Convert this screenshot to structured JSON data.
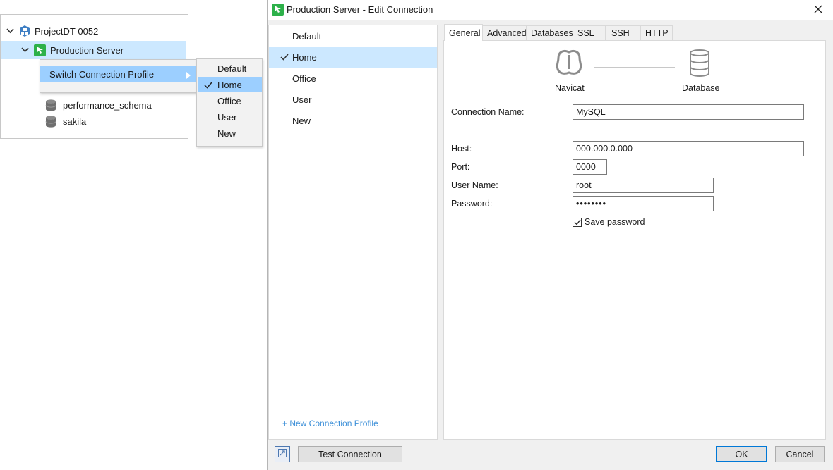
{
  "tree": {
    "project": "ProjectDT-0052",
    "connection": "Production Server",
    "databases": [
      "performance_schema",
      "sakila"
    ]
  },
  "context_menu": {
    "item": "Switch Connection Profile",
    "submenu": [
      "Default",
      "Home",
      "Office",
      "User",
      "New"
    ],
    "checked": "Home"
  },
  "dialog": {
    "title": "Production Server - Edit Connection",
    "profiles": [
      "Default",
      "Home",
      "Office",
      "User",
      "New"
    ],
    "selected_profile": "Home",
    "new_profile_link": "+ New Connection Profile",
    "tabs": [
      "General",
      "Advanced",
      "Databases",
      "SSL",
      "SSH",
      "HTTP"
    ],
    "active_tab": "General",
    "diagram": {
      "left_label": "Navicat",
      "right_label": "Database"
    },
    "form": {
      "connection_name_label": "Connection Name:",
      "connection_name": "MySQL",
      "host_label": "Host:",
      "host": "000.000.0.000",
      "port_label": "Port:",
      "port": "0000",
      "username_label": "User Name:",
      "username": "root",
      "password_label": "Password:",
      "password": "••••••••",
      "save_password_label": "Save password",
      "save_password": true
    },
    "buttons": {
      "test": "Test Connection",
      "ok": "OK",
      "cancel": "Cancel"
    }
  },
  "colors": {
    "selection": "#cce8ff",
    "menu_highlight": "#9ccfff",
    "accent": "#0078d7",
    "link": "#3c8fd8",
    "connection_icon": "#2db14a"
  }
}
